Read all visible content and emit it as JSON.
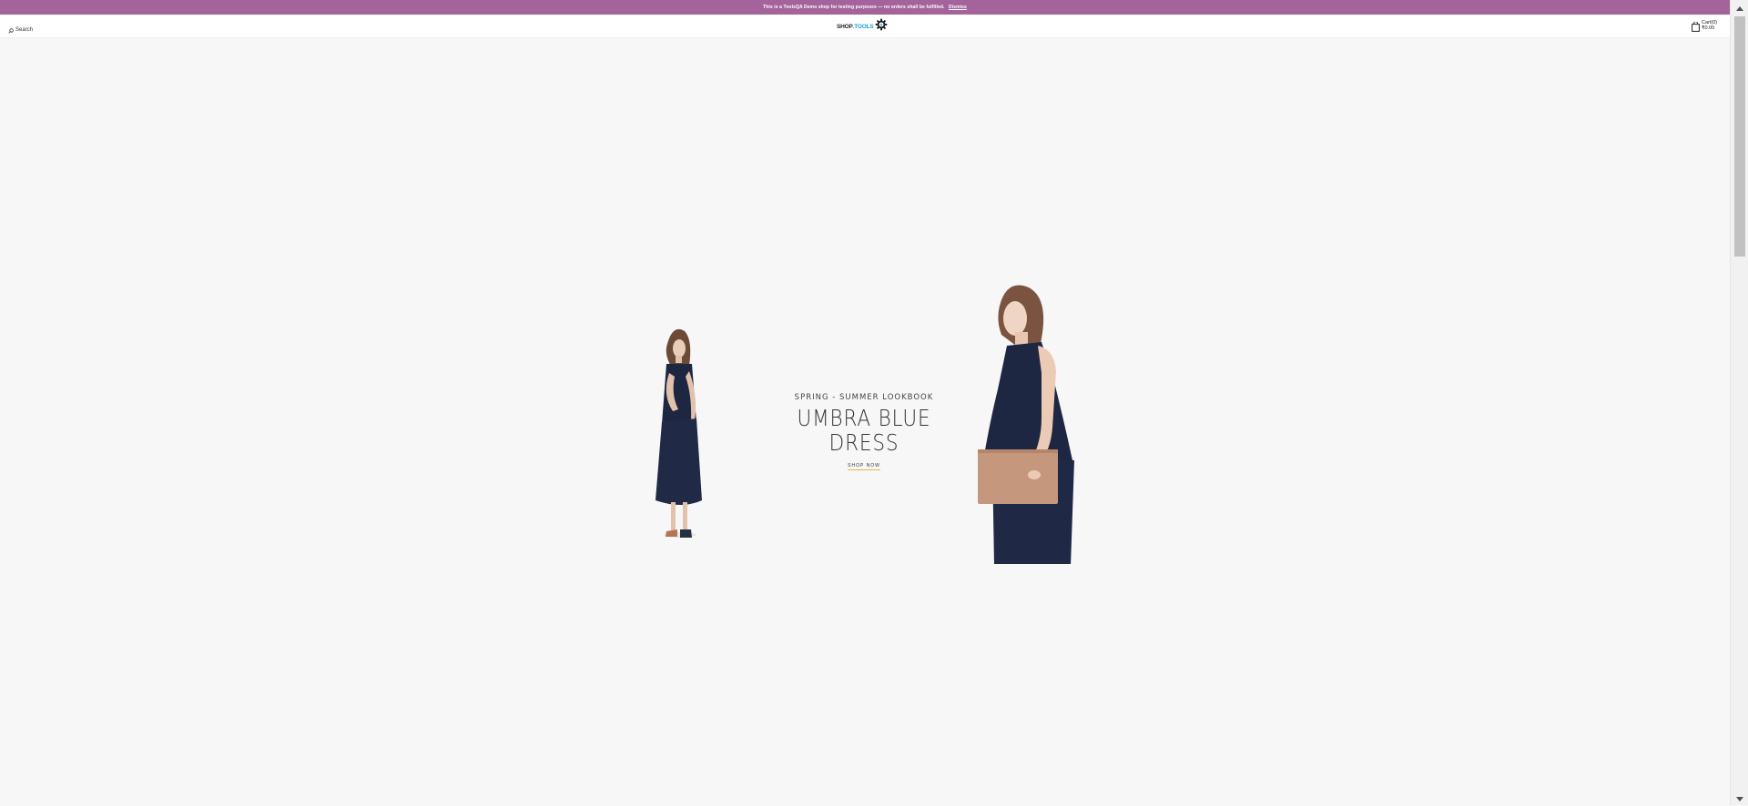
{
  "notice": {
    "text": "This is a ToolsQA Demo shop for testing purposes — no orders shall be fulfilled.",
    "dismiss_label": "Dismiss"
  },
  "header": {
    "search_label": "Search",
    "search_icon": "search-icon",
    "logo_shop": "SHOP",
    "logo_tools": ".TOOLS",
    "logo_icon": "gear-icon",
    "cart_label": "Cart(0)",
    "cart_total": "₹0.00",
    "cart_icon": "shopping-bag-icon"
  },
  "hero": {
    "eyebrow": "SPRING - SUMMER LOOKBOOK",
    "headline_line1": "UMBRA BLUE",
    "headline_line2": "DRESS",
    "cta_label": "SHOP NOW",
    "accent_color": "#e9b936"
  },
  "colors": {
    "notice_bg": "#a4639b",
    "logo_accent": "#1ea0d6",
    "page_bg": "#f7f7f7"
  }
}
